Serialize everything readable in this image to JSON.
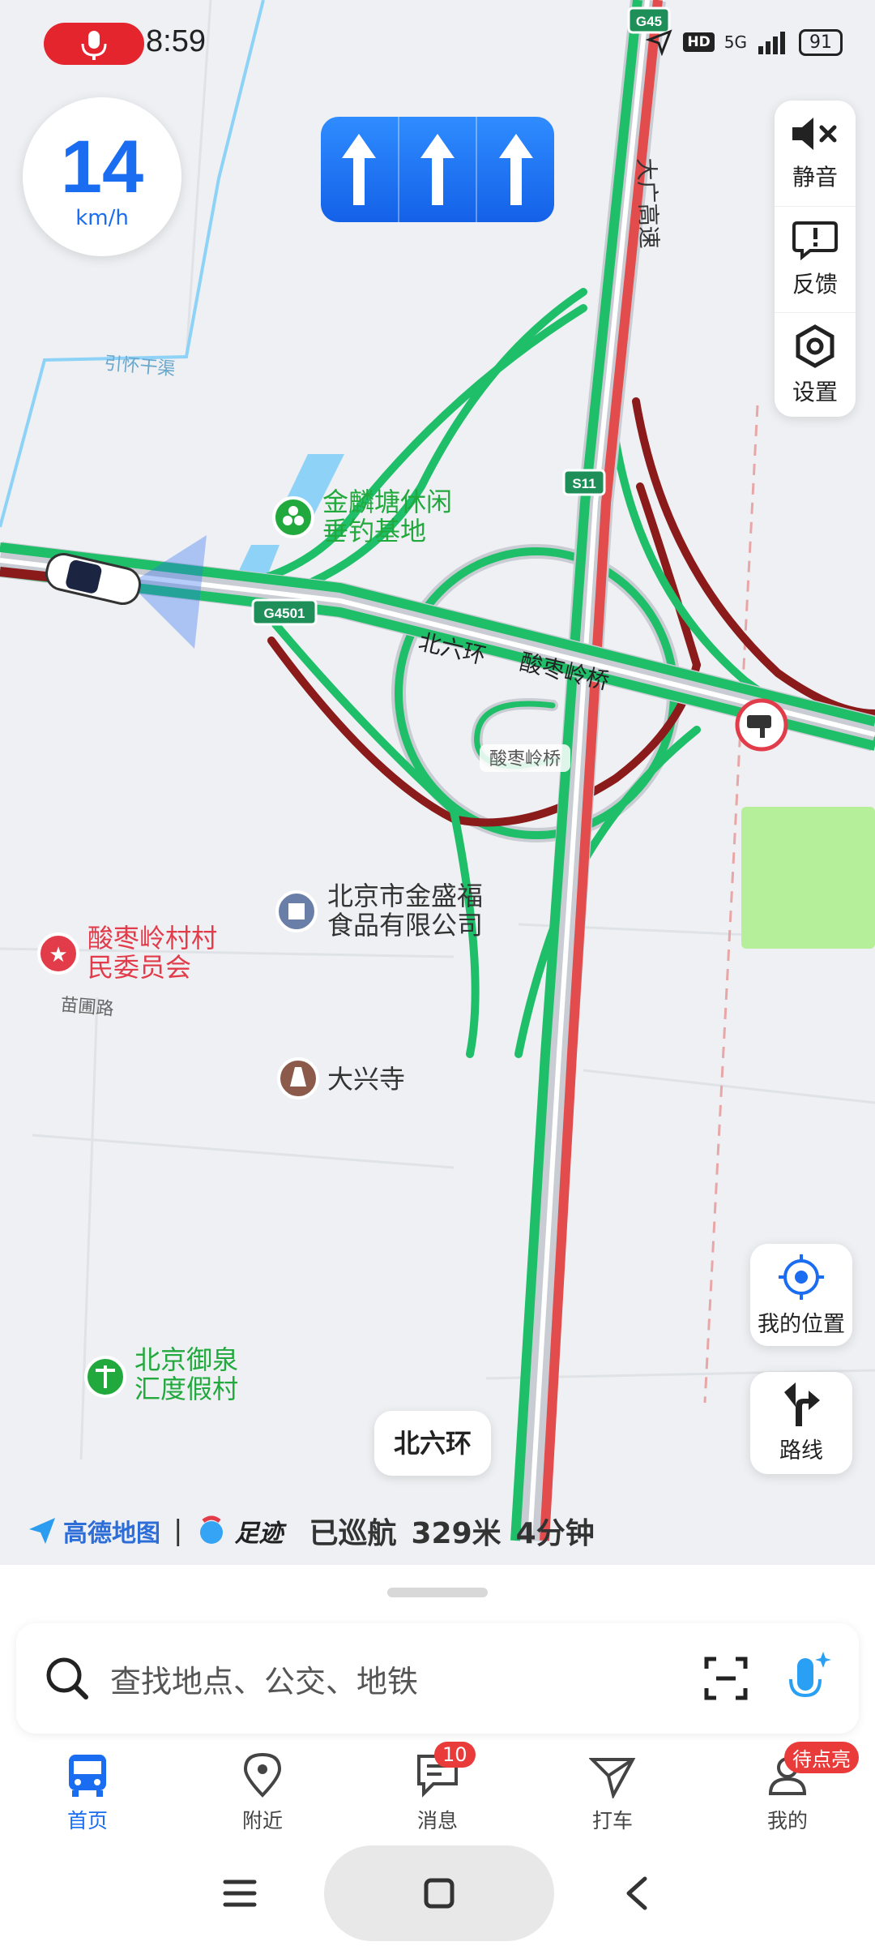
{
  "status_bar": {
    "time": "8:59",
    "hd": "HD",
    "network": "5G",
    "battery": "91"
  },
  "speed": {
    "value": "14",
    "unit": "km/h"
  },
  "map": {
    "route_shields": [
      "G45",
      "S11",
      "G4501"
    ],
    "road_labels": {
      "daguang": "大广高速",
      "beiliuhuan": "北六环",
      "suanzaoling_bridge": "酸枣岭桥",
      "bridge_small": "酸枣岭桥",
      "canal": "引怀干渠",
      "miaopu": "苗圃路"
    },
    "pois": [
      {
        "name_line1": "金麟塘休闲",
        "name_line2": "垂钓基地"
      },
      {
        "name_line1": "北京市金盛福",
        "name_line2": "食品有限公司"
      },
      {
        "name_line1": "酸枣岭村村",
        "name_line2": "民委员会"
      },
      {
        "name_line1": "大兴寺",
        "name_line2": ""
      },
      {
        "name_line1": "北京御泉",
        "name_line2": "汇度假村"
      }
    ],
    "colors": {
      "smooth": "#1fbf6a",
      "jam": "#e34c4c",
      "heavy": "#8b1a1a",
      "water": "#8ed3f7",
      "park": "#b6ef99"
    }
  },
  "tools": {
    "mute": "静音",
    "feedback": "反馈",
    "settings": "设置"
  },
  "side": {
    "my_location": "我的位置",
    "route": "路线"
  },
  "current_road": "北六环",
  "footer": {
    "brand": "高德地图",
    "brand2": "足迹",
    "cruised": "已巡航",
    "distance": "329米",
    "duration": "4分钟"
  },
  "search": {
    "placeholder": "查找地点、公交、地铁"
  },
  "tabs": [
    {
      "label": "首页",
      "badge": ""
    },
    {
      "label": "附近",
      "badge": ""
    },
    {
      "label": "消息",
      "badge": "10"
    },
    {
      "label": "打车",
      "badge": ""
    },
    {
      "label": "我的",
      "badge": "待点亮"
    }
  ]
}
